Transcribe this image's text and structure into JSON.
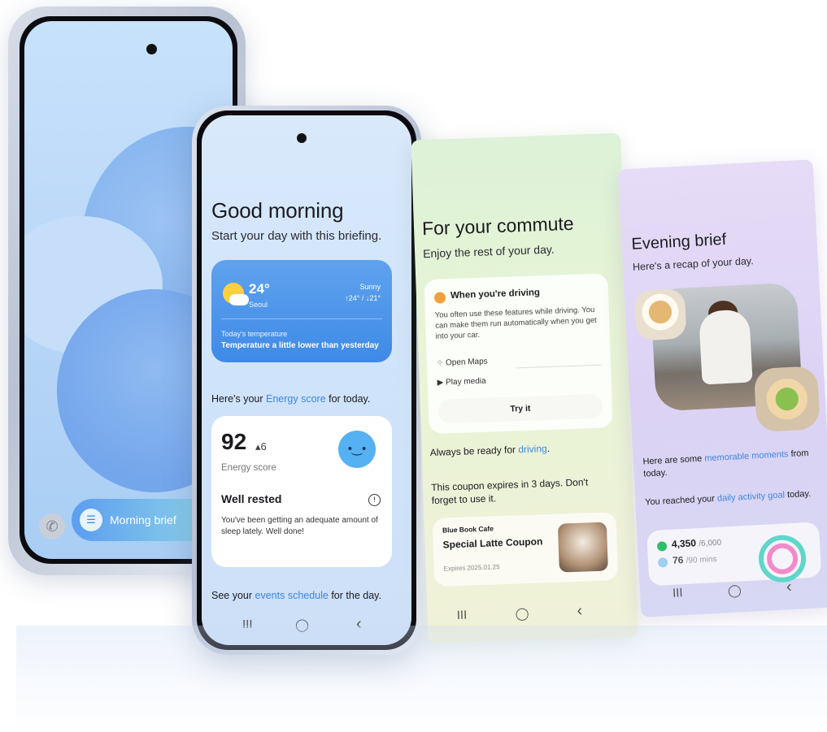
{
  "phone1": {
    "morning_brief_label": "Morning brief",
    "phone_icon": "phone-icon"
  },
  "morning": {
    "title": "Good morning",
    "subtitle": "Start your day with this briefing.",
    "weather": {
      "temp": "24°",
      "city": "Seoul",
      "condition": "Sunny",
      "range": "↑24° / ↓21°",
      "label": "Today's temperature",
      "message": "Temperature a little lower than yesterday"
    },
    "energy_prefix": "Here's your ",
    "energy_link": "Energy score",
    "energy_suffix": " for today.",
    "energy": {
      "score": "92",
      "delta": "▴6",
      "label": "Energy score",
      "status_title": "Well rested",
      "status_desc": "You've been getting an adequate amount of sleep lately. Well done!",
      "face": "•‿•"
    },
    "events_prefix": "See your ",
    "events_link": "events schedule",
    "events_suffix": " for the day."
  },
  "commute": {
    "title": "For your commute",
    "subtitle": "Enjoy the rest of your day.",
    "drive_card": {
      "title": "When you're driving",
      "desc": "You often use these features while driving. You can make them run automatically when you get into your car.",
      "items": [
        "Open Maps",
        "Play media"
      ],
      "button": "Try it"
    },
    "ready_prefix": "Always be ready for ",
    "ready_link": "driving",
    "ready_suffix": ".",
    "coupon_text": "This coupon expires in 3 days. Don't forget to use it.",
    "coupon": {
      "shop": "Blue Book Cafe",
      "name": "Special Latte Coupon",
      "expires": "Expires 2025.01.25"
    }
  },
  "evening": {
    "title": "Evening brief",
    "subtitle": "Here's a recap of your day.",
    "moments_prefix": "Here are some ",
    "moments_link": "memorable moments",
    "moments_suffix": " from today.",
    "goal_prefix": "You reached your ",
    "goal_link": "daily activity goal",
    "goal_suffix": " today.",
    "activity": {
      "steps": "4,350",
      "steps_goal": "/6,000",
      "minutes": "76",
      "minutes_goal": "/90 mins"
    }
  },
  "nav": {
    "recents": "III",
    "home": "◯",
    "back": "‹"
  },
  "colors": {
    "link": "#3d86e2",
    "weather_card": "#4a93ea"
  }
}
